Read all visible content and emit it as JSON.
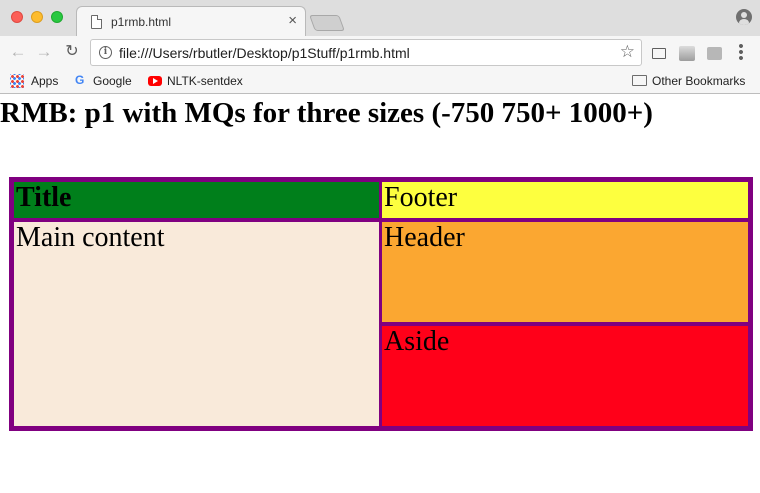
{
  "browser": {
    "tab_title": "p1rmb.html",
    "tab_close": "×",
    "url": "file:///Users/rbutler/Desktop/p1Stuff/p1rmb.html",
    "nav": {
      "back": "←",
      "forward": "→",
      "reload": "↻"
    },
    "star": "☆",
    "menu": "⋮",
    "bookmarks": [
      {
        "label": "Apps",
        "icon": "apps-grid-icon"
      },
      {
        "label": "Google",
        "icon": "google-icon"
      },
      {
        "label": "NLTK-sentdex",
        "icon": "youtube-icon"
      }
    ],
    "other_bookmarks": "Other Bookmarks"
  },
  "page": {
    "heading": "RMB: p1 with MQs for three sizes (-750 750+ 1000+)",
    "cells": {
      "title": "Title",
      "footer": "Footer",
      "main": "Main content",
      "header": "Header",
      "aside": "Aside"
    }
  },
  "colors": {
    "container_border": "#800080",
    "title_bg": "#007f1b",
    "footer_bg": "#fdff3f",
    "main_bg": "#f9eada",
    "header_bg": "#fba731",
    "aside_bg": "#ff0019"
  }
}
